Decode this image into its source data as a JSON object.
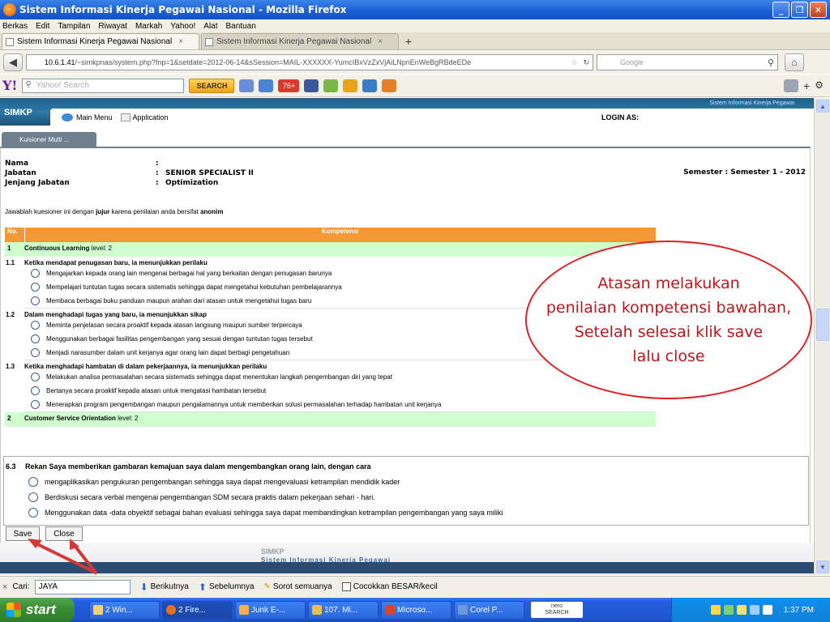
{
  "window": {
    "title": "Sistem Informasi Kinerja Pegawai Nasional - Mozilla Firefox",
    "buttons": [
      "_",
      "❐",
      "✕"
    ]
  },
  "menu": [
    "Berkas",
    "Edit",
    "Tampilan",
    "Riwayat",
    "Markah",
    "Yahoo!",
    "Alat",
    "Bantuan"
  ],
  "tabs": [
    {
      "label": "Sistem Informasi Kinerja Pegawai Nasional",
      "close": "×"
    },
    {
      "label": "Sistem Informasi Kinerja Pegawai Nasional",
      "close": "×"
    }
  ],
  "nav": {
    "url_host": "10.6.1.41",
    "url_rest": "/~simkpnas/system.php?fnp=1&setdate=2012-06-14&sSession=MAIL-XXXXXX-YumcIBxVzZxVjAiLNpnEnWeBgRBdeEDe",
    "search_placeholder": "Google"
  },
  "yahoo": {
    "search_placeholder": "Yahoo! Search",
    "search_button": "SEARCH",
    "mail_badge": "76+"
  },
  "app": {
    "brand": "SIMKP",
    "system_name": "Sistem Informasi Kinerja Pegawai",
    "main_menu": "Main Menu",
    "application": "Application",
    "login": "LOGIN AS:",
    "tab": "Kuisioner Multi ..."
  },
  "employee": {
    "nama_label": "Nama",
    "nama_value": "",
    "jabatan_label": "Jabatan",
    "jabatan_value": "SENIOR SPECIALIST II",
    "jenjang_label": "Jenjang Jabatan",
    "jenjang_value": "Optimization",
    "colon": ":",
    "semester": "Semester : Semester 1 - 2012"
  },
  "instruction": {
    "pre": "Jawablah kuesioner ini dengan ",
    "b1": "jujur",
    "mid": " karena penilaian anda bersifat ",
    "b2": "anonim"
  },
  "table": {
    "col_no": "No.",
    "col_kompetensi": "Kompetensi",
    "competency1": {
      "no": "1",
      "name": "Continuous Learning",
      "level": " level: 2"
    },
    "sections": [
      {
        "no": "1.1",
        "title": "Ketika mendapat penugasan baru, ia menunjukkan perilaku",
        "options": [
          "Mengajarkan kepada orang lain mengenai berbagai hal yang berkaitan dengan penugasan barunya",
          "Mempelajari tuntutan tugas secara sistematis sehingga dapat mengetahui kebutuhan pembelajarannya",
          "Membaca berbagai buku panduan maupun arahan dari atasan untuk mengetahui tugas baru"
        ]
      },
      {
        "no": "1.2",
        "title": "Dalam menghadapi tugas yang baru, ia menunjukkan sikap",
        "options": [
          "Meminta penjelasan secara proaktif kepada atasan langsung maupun sumber terpercaya",
          "Menggunakan berbagai fasilitas pengembangan yang sesuai dengan tuntutan tugas tersebut",
          "Menjadi narasumber dalam unit kerjanya agar orang lain dapat berbagi pengetahuan"
        ]
      },
      {
        "no": "1.3",
        "title": "Ketika menghadapi hambatan di dalam pekerjaannya, ia menunjukkan perilaku",
        "options": [
          "Melakukan analisa permasalahan secara sistematis sehingga dapat menentukan langkah pengembangan diri yang tepat",
          "Bertanya secara proaktif kepada atasan untuk mengatasi hambatan tersebut",
          "Menerapkan program pengembangan maupun pengalamannya untuk memberikan solusi permasalahan terhadap hambatan unit kerjanya"
        ]
      }
    ],
    "competency2": {
      "no": "2",
      "name": "Customer Service Orientation",
      "level": " level: 2"
    }
  },
  "q63": {
    "no": "6.3",
    "title": "Rekan Saya memberikan gambaran kemajuan saya dalam mengembangkan orang lain, dengan cara",
    "options": [
      "mengaplikasikan pengukuran pengembangan sehingga saya dapat mengevaluasi ketrampilan mendidik kader",
      "Berdiskusi secara verbal mengenai pengembangan SDM secara praktis dalam pekerjaan sehari - hari.",
      "Menggunakan data -data obyektif sebagai bahan evaluasi sehingga saya dapat membandingkan ketrampilan pengembangan yang saya miliki"
    ]
  },
  "buttons": {
    "save": "Save",
    "close": "Close"
  },
  "footer": {
    "brand": "SIMKP",
    "name": "Sistem Informasi Kinerja Pegawai"
  },
  "callout": {
    "line1": "Atasan melakukan",
    "line2": "penilaian kompetensi bawahan,",
    "line3": "Setelah selesai klik save",
    "line4": "lalu close",
    "color": "#e02020"
  },
  "findbar": {
    "close": "×",
    "label": "Cari:",
    "value": "JAYA",
    "next": "Berikutnya",
    "prev": "Sebelumnya",
    "highlight": "Sorot semuanya",
    "matchcase": "Cocokkan BESAR/kecil"
  },
  "taskbar": {
    "start": "start",
    "tasks": [
      "2 Win...",
      "2 Fire...",
      "Junk E-...",
      "107. Mi...",
      "Microso...",
      "Corel P..."
    ],
    "nero_line1": "nero",
    "nero_line2": "SEARCH",
    "clock": "1:37 PM"
  }
}
